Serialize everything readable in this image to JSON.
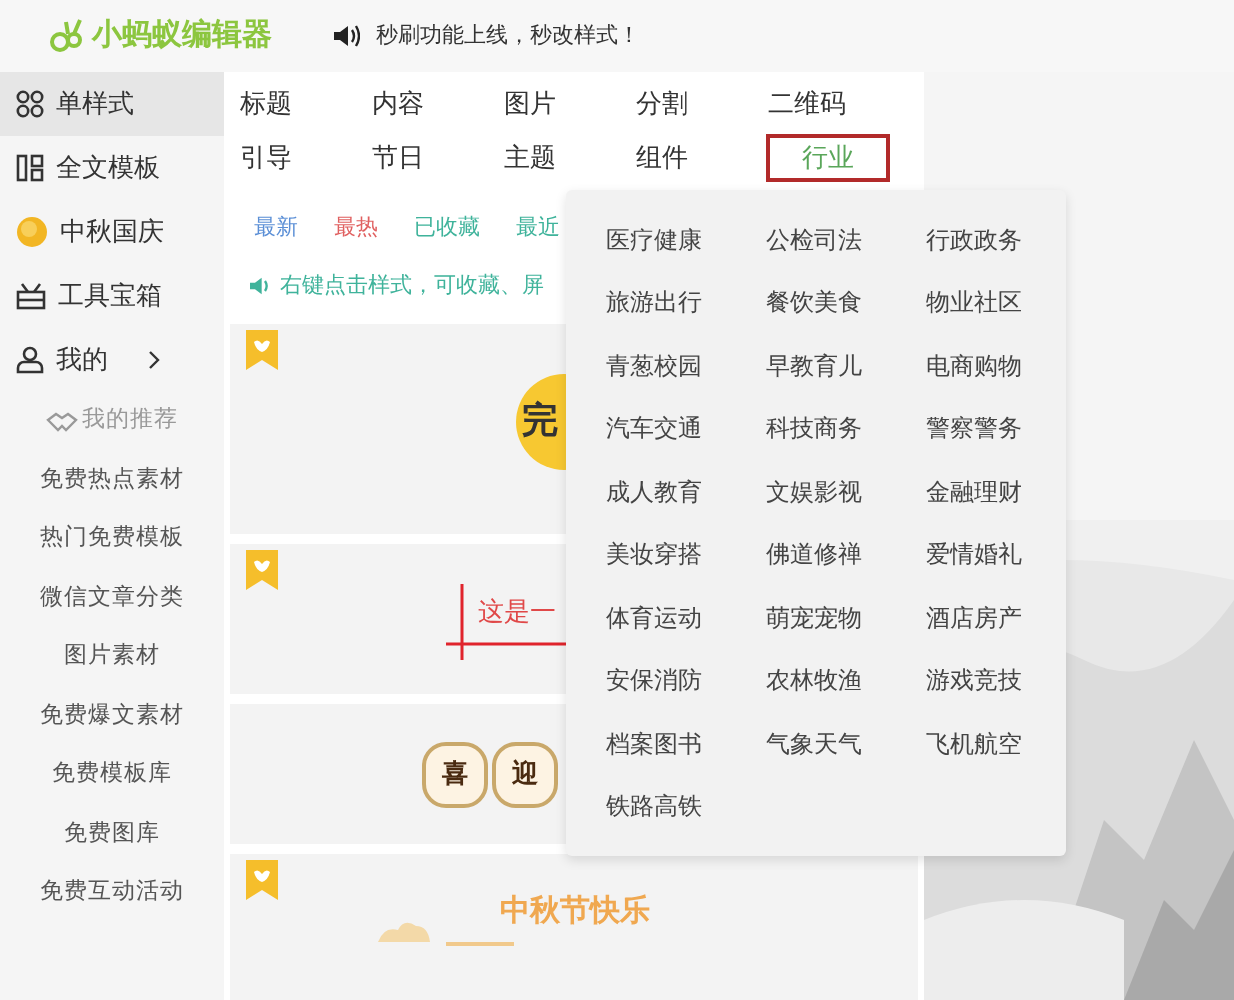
{
  "header": {
    "logo": "小蚂蚁编辑器",
    "notice": "秒刷功能上线，秒改样式！"
  },
  "sidebar": {
    "items": [
      {
        "label": "单样式",
        "kind": "grid",
        "selected": true
      },
      {
        "label": "全文模板",
        "kind": "template",
        "selected": false
      },
      {
        "label": "中秋国庆",
        "kind": "moon",
        "selected": false
      },
      {
        "label": "工具宝箱",
        "kind": "toolbox",
        "selected": false
      },
      {
        "label": "我的",
        "kind": "user",
        "selected": false
      }
    ],
    "sub_items": [
      {
        "label": "我的推荐",
        "kind": "recommend"
      },
      {
        "label": "免费热点素材",
        "kind": "link"
      },
      {
        "label": "热门免费模板",
        "kind": "link"
      },
      {
        "label": "微信文章分类",
        "kind": "link"
      },
      {
        "label": "图片素材",
        "kind": "link"
      },
      {
        "label": "免费爆文素材",
        "kind": "link"
      },
      {
        "label": "免费模板库",
        "kind": "link"
      },
      {
        "label": "免费图库",
        "kind": "link"
      },
      {
        "label": "免费互动活动",
        "kind": "link"
      }
    ]
  },
  "tabs": [
    {
      "label": "标题",
      "selected": false
    },
    {
      "label": "内容",
      "selected": false
    },
    {
      "label": "图片",
      "selected": false
    },
    {
      "label": "分割",
      "selected": false
    },
    {
      "label": "二维码",
      "selected": false
    },
    {
      "label": "引导",
      "selected": false
    },
    {
      "label": "节日",
      "selected": false
    },
    {
      "label": "主题",
      "selected": false
    },
    {
      "label": "组件",
      "selected": false
    },
    {
      "label": "行业",
      "selected": true
    }
  ],
  "filters": [
    {
      "label": "最新",
      "color": "#5b8fd6"
    },
    {
      "label": "最热",
      "color": "#e06060"
    },
    {
      "label": "已收藏",
      "color": "#3fb39b"
    },
    {
      "label": "最近",
      "color": "#3fb39b"
    }
  ],
  "tip": "右键点击样式，可收藏、屏",
  "cards": [
    {
      "kind": "circle-title",
      "text": "完",
      "bookmarked": true
    },
    {
      "kind": "red-title",
      "text": "这是一",
      "bookmarked": true
    },
    {
      "kind": "seal-pair",
      "texts": [
        "喜",
        "迎"
      ],
      "bookmarked": false
    },
    {
      "kind": "festival-title",
      "text": "中秋节快乐",
      "bookmarked": true
    }
  ],
  "dropdown": {
    "items": [
      "医疗健康",
      "公检司法",
      "行政政务",
      "旅游出行",
      "餐饮美食",
      "物业社区",
      "青葱校园",
      "早教育儿",
      "电商购物",
      "汽车交通",
      "科技商务",
      "警察警务",
      "成人教育",
      "文娱影视",
      "金融理财",
      "美妆穿搭",
      "佛道修禅",
      "爱情婚礼",
      "体育运动",
      "萌宠宠物",
      "酒店房产",
      "安保消防",
      "农林牧渔",
      "游戏竞技",
      "档案图书",
      "气象天气",
      "飞机航空",
      "铁路高铁"
    ]
  }
}
